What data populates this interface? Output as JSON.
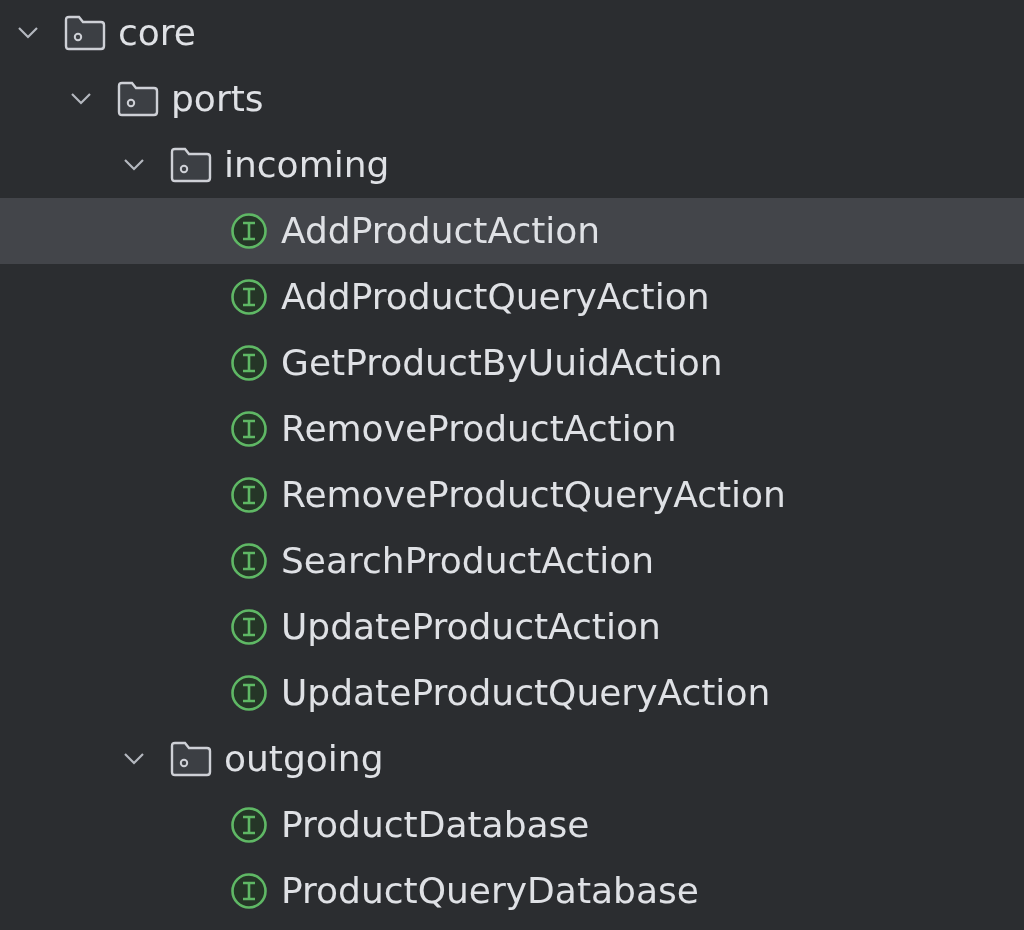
{
  "project_tree": [
    {
      "kind": "folder",
      "label": "core",
      "expanded": true,
      "selected": false,
      "children": [
        {
          "kind": "folder",
          "label": "ports",
          "expanded": true,
          "selected": false,
          "children": [
            {
              "kind": "folder",
              "label": "incoming",
              "expanded": true,
              "selected": false,
              "children": [
                {
                  "kind": "interface",
                  "label": "AddProductAction",
                  "selected": true
                },
                {
                  "kind": "interface",
                  "label": "AddProductQueryAction",
                  "selected": false
                },
                {
                  "kind": "interface",
                  "label": "GetProductByUuidAction",
                  "selected": false
                },
                {
                  "kind": "interface",
                  "label": "RemoveProductAction",
                  "selected": false
                },
                {
                  "kind": "interface",
                  "label": "RemoveProductQueryAction",
                  "selected": false
                },
                {
                  "kind": "interface",
                  "label": "SearchProductAction",
                  "selected": false
                },
                {
                  "kind": "interface",
                  "label": "UpdateProductAction",
                  "selected": false
                },
                {
                  "kind": "interface",
                  "label": "UpdateProductQueryAction",
                  "selected": false
                }
              ]
            },
            {
              "kind": "folder",
              "label": "outgoing",
              "expanded": true,
              "selected": false,
              "children": [
                {
                  "kind": "interface",
                  "label": "ProductDatabase",
                  "selected": false
                },
                {
                  "kind": "interface",
                  "label": "ProductQueryDatabase",
                  "selected": false
                }
              ]
            }
          ]
        }
      ]
    }
  ]
}
